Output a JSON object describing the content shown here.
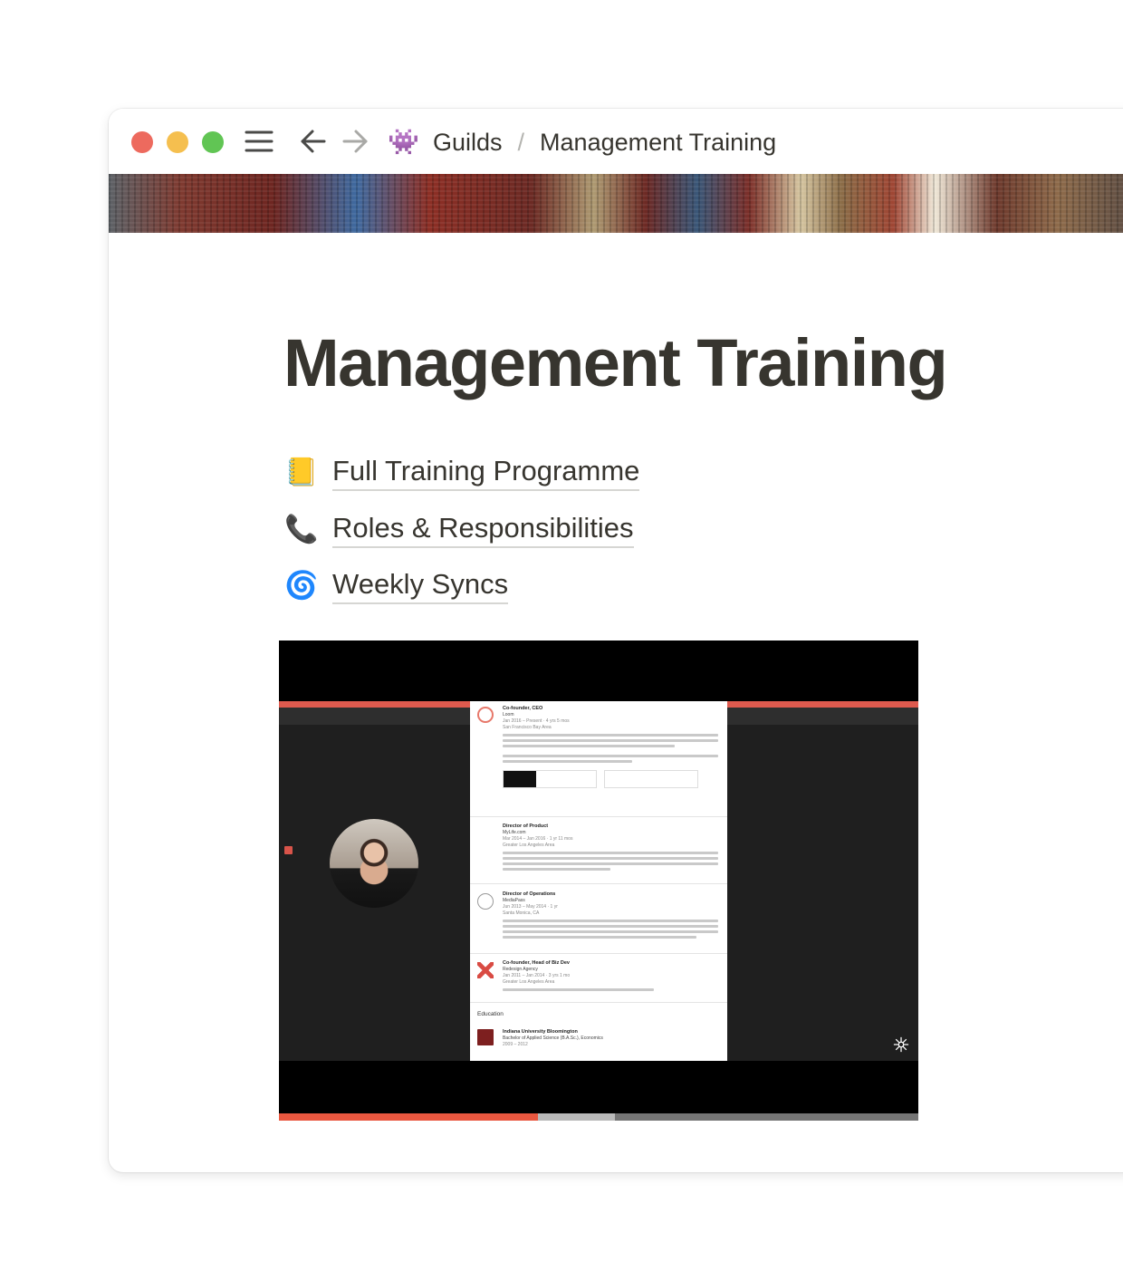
{
  "window": {
    "breadcrumb": {
      "emoji": "👾",
      "parent": "Guilds",
      "separator": "/",
      "current": "Management Training"
    }
  },
  "page": {
    "title": "Management Training",
    "links": [
      {
        "emoji": "📒",
        "label": "Full Training Programme"
      },
      {
        "emoji": "📞",
        "label": "Roles & Responsibilities"
      },
      {
        "emoji": "🌀",
        "label": "Weekly Syncs"
      }
    ]
  },
  "video": {
    "progress_fraction": 0.405,
    "profile": {
      "entries": [
        {
          "title": "Co-founder, CEO",
          "company": "Loom",
          "dates": "Jan 2016 – Present · 4 yrs 5 mos",
          "location": "San Francisco Bay Area"
        },
        {
          "title": "Director of Product",
          "company": "MyLife.com",
          "dates": "Mar 2014 – Jan 2016 · 1 yr 11 mos",
          "location": "Greater Los Angeles Area"
        },
        {
          "title": "Director of Operations",
          "company": "MediaPass",
          "dates": "Jun 2013 – May 2014 · 1 yr",
          "location": "Santa Monica, CA"
        },
        {
          "title": "Co-founder, Head of Biz Dev",
          "company": "Redesign Agency",
          "dates": "Jan 2011 – Jan 2014 · 3 yrs 1 mo",
          "location": "Greater Los Angeles Area"
        }
      ],
      "education_heading": "Education",
      "school": "Indiana University Bloomington",
      "degree": "Bachelor of Applied Science (B.A.Sc.), Economics",
      "school_dates": "2009 – 2012"
    }
  },
  "colors": {
    "text": "#37352f",
    "traffic_red": "#ed6a5e",
    "traffic_yellow": "#f5bf4f",
    "traffic_green": "#61c554",
    "progress": "#e9573f"
  }
}
